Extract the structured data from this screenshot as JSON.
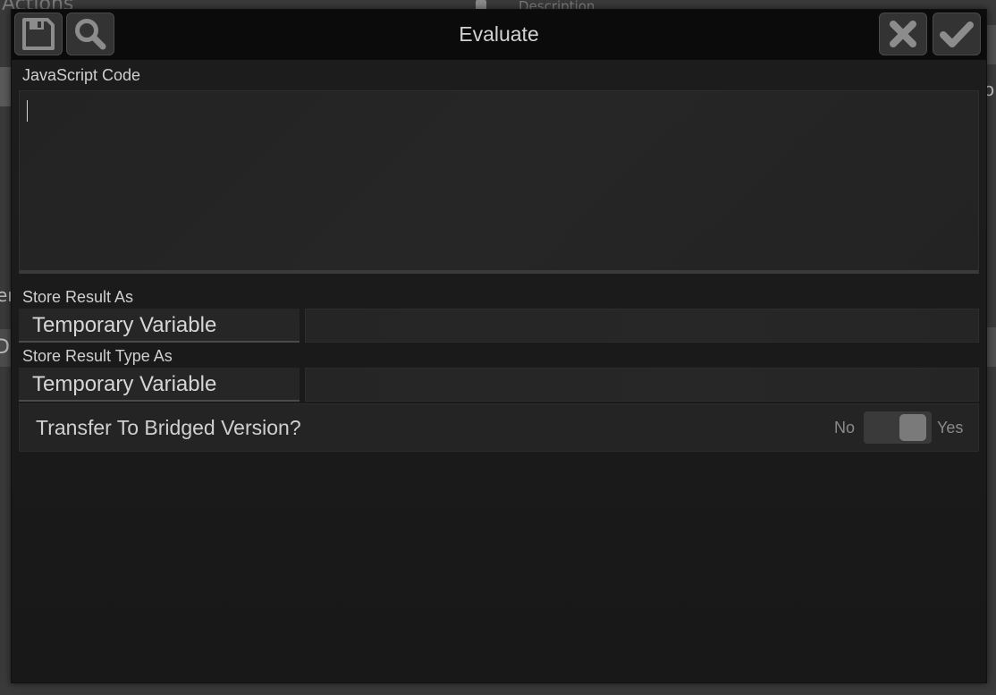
{
  "background": {
    "actions_title": "Actions",
    "description_title": "Description",
    "left_fragment_1": "er",
    "left_fragment_2": "D",
    "right_fragment": "o"
  },
  "window": {
    "title": "Evaluate"
  },
  "toolbar": {
    "save_icon": "floppy-disk-icon",
    "search_icon": "magnifier-icon",
    "cancel_icon": "x-icon",
    "ok_icon": "checkmark-icon"
  },
  "form": {
    "code_label": "JavaScript Code",
    "code_value": "",
    "store_result_label": "Store Result As",
    "store_result_option": "Temporary Variable",
    "store_result_name": "",
    "store_type_label": "Store Result Type As",
    "store_type_option": "Temporary Variable",
    "store_type_name": "",
    "transfer_label": "Transfer To Bridged Version?",
    "toggle_no": "No",
    "toggle_yes": "Yes",
    "transfer_value": "Yes"
  },
  "colors": {
    "modal_bg": "#1b1b1b",
    "titlebar_bg": "#0b0b0b",
    "button_bg": "#333333",
    "input_bg": "#262626",
    "text": "#cfcfcf"
  }
}
